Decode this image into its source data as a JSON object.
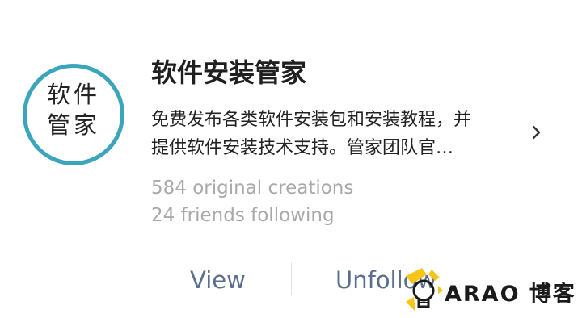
{
  "account": {
    "avatar_line1": "软件",
    "avatar_line2": "管家",
    "name": "软件安装管家",
    "description_line1": "免费发布各类软件安装包和安装教程，并",
    "description_line2": "提供软件安装技术支持。管家团队官…",
    "original_creations": "584 original creations",
    "friends_following": "24 friends following"
  },
  "actions": {
    "view_label": "View",
    "unfollow_label": "Unfollow"
  },
  "watermark": {
    "text": "ARAO 博客"
  },
  "icons": {
    "more": "chevron-right-icon",
    "watermark": "lightbulb-icon"
  },
  "colors": {
    "avatar_ring": "#3ba6bb",
    "action_text": "#5b6f8d",
    "secondary_text": "#a9a9a9",
    "watermark_accent": "#f5c518"
  }
}
